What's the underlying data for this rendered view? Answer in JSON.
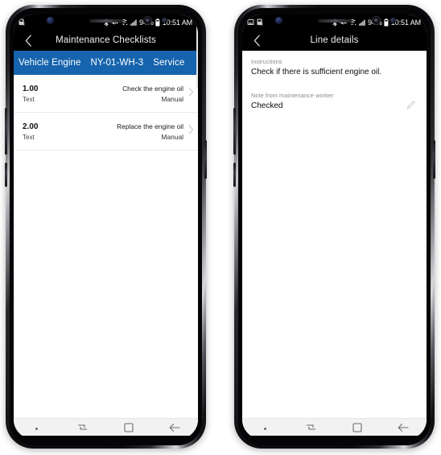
{
  "phones": {
    "left": {
      "status_bar": {
        "left_icons": [
          "app-notification-icon"
        ],
        "bluetooth": "bluetooth-icon",
        "mute": "mute-icon",
        "wifi": "wifi-icon",
        "signal": "signal-bars-icon",
        "battery_percent": "94%",
        "battery": "battery-icon",
        "time": "10:51 AM"
      },
      "title_bar": {
        "back": "back-chevron-icon",
        "title": "Maintenance Checklists"
      },
      "context_header": {
        "items": [
          "Vehicle Engine",
          "NY-01-WH-3",
          "Service"
        ]
      },
      "list": {
        "rows": [
          {
            "number": "1.00",
            "type": "Text",
            "title": "Check the engine oil",
            "mode": "Manual",
            "chevron": "chevron-right-icon"
          },
          {
            "number": "2.00",
            "type": "Text",
            "title": "Replace the engine oil",
            "mode": "Manual",
            "chevron": "chevron-right-icon"
          }
        ]
      }
    },
    "right": {
      "status_bar": {
        "left_icons": [
          "screenshot-icon",
          "app-notification-icon"
        ],
        "bluetooth": "bluetooth-icon",
        "mute": "mute-icon",
        "wifi": "wifi-icon",
        "signal": "signal-bars-icon",
        "battery_percent": "94%",
        "battery": "battery-icon",
        "time": "10:51 AM"
      },
      "title_bar": {
        "back": "back-chevron-icon",
        "title": "Line details"
      },
      "fields": [
        {
          "label": "Instructions",
          "value": "Check if there is sufficient engine oil."
        },
        {
          "label": "Note from maintenance worker",
          "value": "Checked",
          "edit_icon": "pencil-icon"
        }
      ]
    }
  },
  "nav_bar": {
    "buttons": [
      {
        "name": "nav-dot",
        "icon": "dot-icon"
      },
      {
        "name": "nav-recents",
        "icon": "multitask-icon"
      },
      {
        "name": "nav-home",
        "icon": "home-square-icon"
      },
      {
        "name": "nav-back",
        "icon": "back-arrow-icon"
      }
    ]
  },
  "colors": {
    "accent_blue": "#1664ad",
    "status_bar_bg": "#000000",
    "nav_bar_bg": "#f2f2f2",
    "chevron_gray": "#c9c9c9"
  }
}
